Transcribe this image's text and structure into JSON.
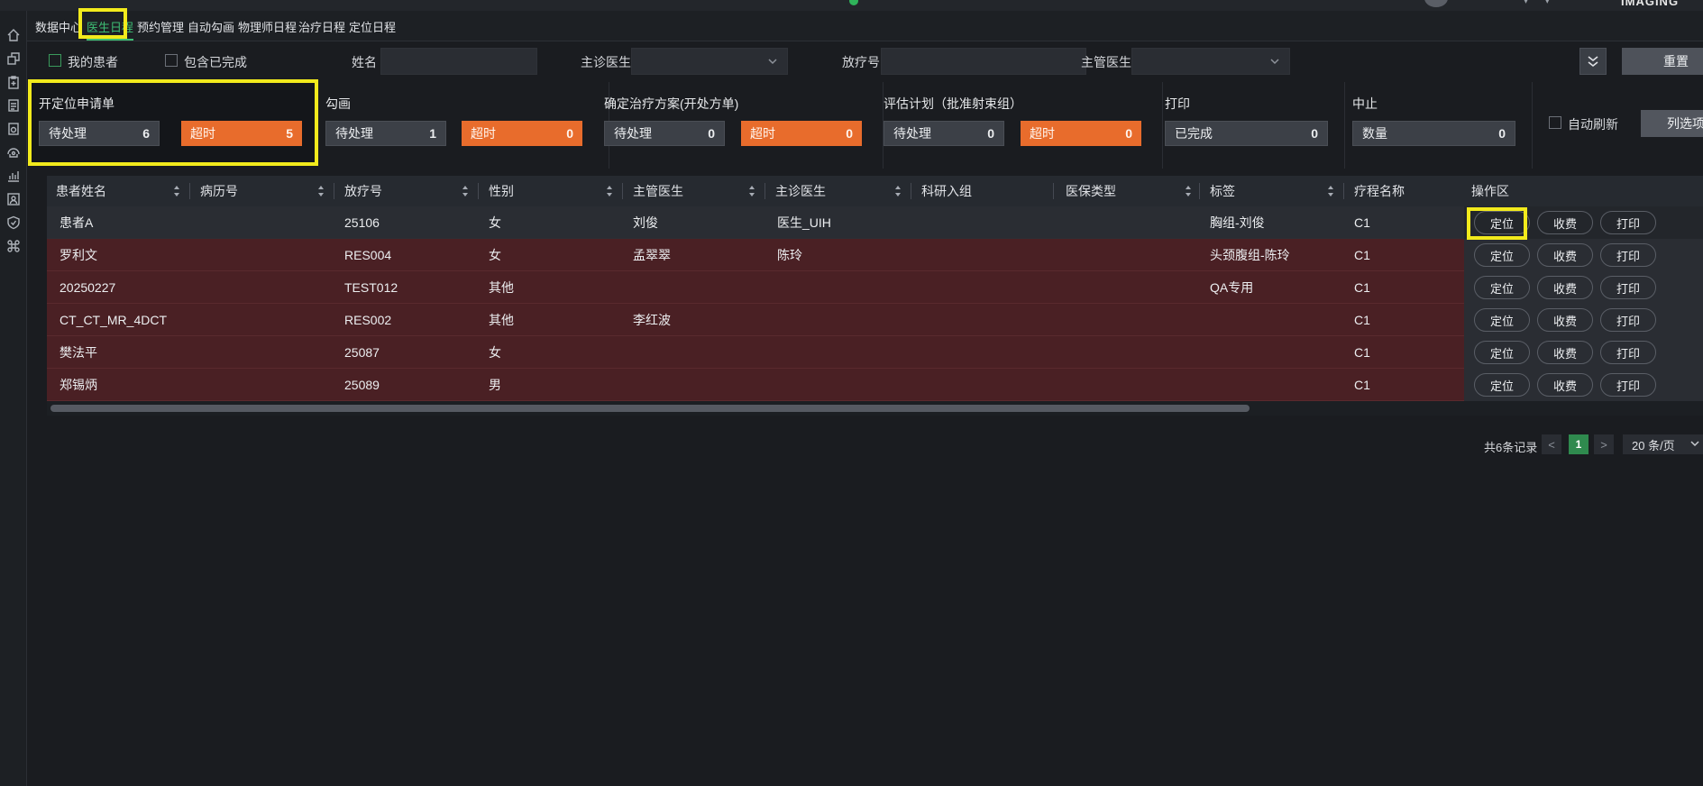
{
  "topbar": {
    "brand": "IMAGING"
  },
  "nav": {
    "tabs": [
      {
        "label": "数据中心"
      },
      {
        "label": "医生日程",
        "active": true
      },
      {
        "label": "预约管理"
      },
      {
        "label": "自动勾画"
      },
      {
        "label": "物理师日程"
      },
      {
        "label": "治疗日程"
      },
      {
        "label": "定位日程"
      }
    ]
  },
  "filters": {
    "my_patients": "我的患者",
    "include_completed": "包含已完成",
    "name_label": "姓名",
    "attending_label": "主诊医生",
    "rt_no_label": "放疗号",
    "chief_label": "主管医生",
    "reset": "重置"
  },
  "stages": [
    {
      "title": "开定位申请单",
      "pending_label": "待处理",
      "pending": "6",
      "overdue_label": "超时",
      "overdue": "5"
    },
    {
      "title": "勾画",
      "pending_label": "待处理",
      "pending": "1",
      "overdue_label": "超时",
      "overdue": "0"
    },
    {
      "title": "确定治疗方案(开处方单)",
      "pending_label": "待处理",
      "pending": "0",
      "overdue_label": "超时",
      "overdue": "0"
    },
    {
      "title": "评估计划（批准射束组）",
      "pending_label": "待处理",
      "pending": "0",
      "overdue_label": "超时",
      "overdue": "0"
    },
    {
      "title": "打印",
      "done_label": "已完成",
      "done": "0"
    },
    {
      "title": "中止",
      "count_label": "数量",
      "count": "0"
    }
  ],
  "auto_refresh": "自动刷新",
  "list_options": "列选项",
  "table": {
    "headers": [
      "患者姓名",
      "病历号",
      "放疗号",
      "性别",
      "主管医生",
      "主诊医生",
      "科研入组",
      "医保类型",
      "标签",
      "疗程名称",
      "操作区"
    ],
    "rows": [
      [
        "患者A",
        "",
        "25106",
        "女",
        "刘俊",
        "医生_UIH",
        "",
        "",
        "胸组-刘俊",
        "C1"
      ],
      [
        "罗利文",
        "",
        "RES004",
        "女",
        "孟翠翠",
        "陈玲",
        "",
        "",
        "头颈腹组-陈玲",
        "C1"
      ],
      [
        "20250227",
        "",
        "TEST012",
        "其他",
        "",
        "",
        "",
        "",
        "QA专用",
        "C1"
      ],
      [
        "CT_CT_MR_4DCT",
        "",
        "RES002",
        "其他",
        "李红波",
        "",
        "",
        "",
        "",
        "C1"
      ],
      [
        "樊法平",
        "",
        "25087",
        "女",
        "",
        "",
        "",
        "",
        "",
        "C1"
      ],
      [
        "郑锡炳",
        "",
        "25089",
        "男",
        "",
        "",
        "",
        "",
        "",
        "C1"
      ]
    ],
    "actions": [
      "定位",
      "收费",
      "打印"
    ]
  },
  "pagination": {
    "total": "共6条记录",
    "prev": "<",
    "page": "1",
    "next": ">",
    "page_size": "20 条/页"
  },
  "colors": {
    "accent_green": "#3dbd74",
    "overdue_orange": "#e86c2c",
    "row_red": "#4a2024",
    "highlight_yellow": "#f2ea1c"
  }
}
